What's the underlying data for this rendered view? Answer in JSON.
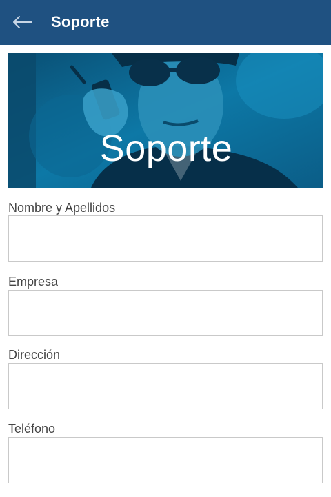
{
  "appbar": {
    "title": "Soporte",
    "back_icon": "arrow-left-icon",
    "background": "#1f5181"
  },
  "banner": {
    "text": "Soporte",
    "image": "security-guard-with-radio"
  },
  "form": {
    "fields": [
      {
        "label": "Nombre y Apellidos",
        "value": ""
      },
      {
        "label": "Empresa",
        "value": ""
      },
      {
        "label": "Dirección",
        "value": ""
      },
      {
        "label": "Teléfono",
        "value": ""
      }
    ]
  }
}
